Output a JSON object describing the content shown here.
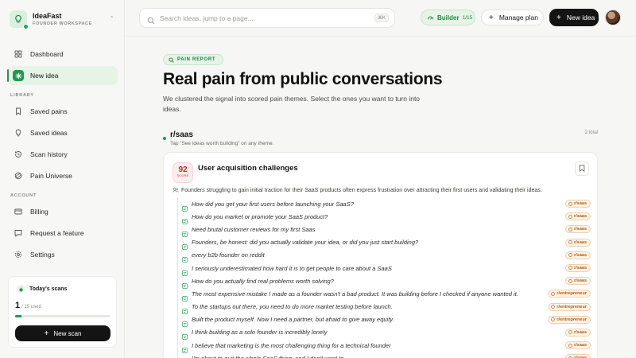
{
  "brand": {
    "name": "IdeaFast",
    "subtitle": "FOUNDER WORKSPACE"
  },
  "nav": {
    "dashboard": "Dashboard",
    "new_idea": "New idea",
    "library_label": "LIBRARY",
    "saved_pains": "Saved pains",
    "saved_ideas": "Saved ideas",
    "scan_history": "Scan history",
    "pain_universe": "Pain Universe",
    "account_label": "ACCOUNT",
    "billing": "Billing",
    "request_feature": "Request a feature",
    "settings": "Settings"
  },
  "scans": {
    "title": "Today's scans",
    "used": "1",
    "limit": "/ 15 used",
    "progress_fraction": 0.07,
    "button": "New scan"
  },
  "topbar": {
    "search_placeholder": "Search ideas, jump to a page...",
    "search_shortcut": "⌘K",
    "plan_name": "Builder",
    "plan_quota": "1/15",
    "manage_plan": "Manage plan",
    "new_idea": "New idea"
  },
  "report": {
    "tag": "PAIN REPORT",
    "title": "Real pain from public conversations",
    "description": "We clustered the signal into scored pain themes. Select the ones you want to turn into ideas."
  },
  "subreddit": {
    "name": "r/saas",
    "hint": "Tap “See ideas worth building” on any theme.",
    "total": "2 total"
  },
  "theme": {
    "score": "92",
    "score_label": "SCORE",
    "title": "User acquisition challenges",
    "summary": "Founders struggling to gain initial traction for their SaaS products often express frustration over attracting their first users and validating their ideas.",
    "posts": [
      {
        "text": "How did you get your first users before launching your SaaS?",
        "source": "r/saas"
      },
      {
        "text": "How do you market or promote your SaaS product?",
        "source": "r/saas"
      },
      {
        "text": "Need brutal customer reviews for my first Saas",
        "source": "r/saas"
      },
      {
        "text": "Founders, be honest: did you actually validate your idea, or did you just start building?",
        "source": "r/saas"
      },
      {
        "text": "every b2b founder on reddit",
        "source": "r/saas"
      },
      {
        "text": "I seriously underestimated how hard it is to get people to care about a SaaS",
        "source": "r/saas"
      },
      {
        "text": "How do you actually find real problems worth solving?",
        "source": "r/saas"
      },
      {
        "text": "The most expensive mistake I made as a founder wasn't a bad product. It was building before I checked if anyone wanted it.",
        "source": "r/entrepreneur"
      },
      {
        "text": "To the startups out there, you need to do more market testing before launch.",
        "source": "r/entrepreneur"
      },
      {
        "text": "Built the product myself. Now I need a partner, but afraid to give away equity.",
        "source": "r/entrepreneur"
      },
      {
        "text": "I think building as a solo founder is incredibly lonely",
        "source": "r/saas"
      },
      {
        "text": "I believe that marketing is the most challenging thing for a technical founder",
        "source": "r/saas"
      },
      {
        "text": "I'm about to quit the whole SaaS thing, and I don't want to",
        "source": "r/saas"
      }
    ]
  },
  "colors": {
    "accent": "#1f9a4f",
    "score_red": "#c62828",
    "badge_orange": "#b85a10"
  }
}
